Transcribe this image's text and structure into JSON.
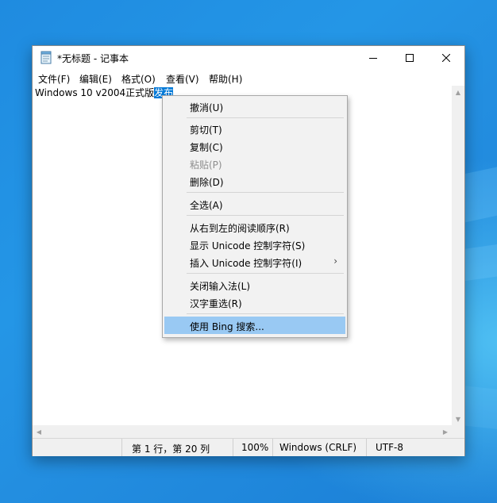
{
  "window": {
    "title": "*无标题 - 记事本",
    "min_glyph": "—",
    "max_glyph": "☐",
    "close_glyph": "✕"
  },
  "menubar": {
    "items": [
      {
        "label": "文件(F)"
      },
      {
        "label": "编辑(E)"
      },
      {
        "label": "格式(O)"
      },
      {
        "label": "查看(V)"
      },
      {
        "label": "帮助(H)"
      }
    ]
  },
  "editor": {
    "text_unselected": "Windows 10 v2004正式版",
    "text_selected": "发布"
  },
  "context_menu": {
    "items": [
      {
        "label": "撤消(U)",
        "enabled": true
      },
      {
        "label": "剪切(T)",
        "enabled": true
      },
      {
        "label": "复制(C)",
        "enabled": true
      },
      {
        "label": "粘贴(P)",
        "enabled": false
      },
      {
        "label": "删除(D)",
        "enabled": true
      },
      {
        "label": "全选(A)",
        "enabled": true
      },
      {
        "label": "从右到左的阅读顺序(R)",
        "enabled": true
      },
      {
        "label": "显示 Unicode 控制字符(S)",
        "enabled": true
      },
      {
        "label": "插入 Unicode 控制字符(I)",
        "enabled": true,
        "submenu_glyph": "›"
      },
      {
        "label": "关闭输入法(L)",
        "enabled": true
      },
      {
        "label": "汉字重选(R)",
        "enabled": true
      },
      {
        "label": "使用 Bing 搜索...",
        "enabled": true,
        "highlighted": true
      }
    ]
  },
  "statusbar": {
    "position": "第 1 行，第 20 列",
    "zoom": "100%",
    "line_ending": "Windows (CRLF)",
    "encoding": "UTF-8"
  },
  "colors": {
    "selection": "#0078d7",
    "menu_highlight": "#99c9f3",
    "desktop": "#1f8be0"
  }
}
